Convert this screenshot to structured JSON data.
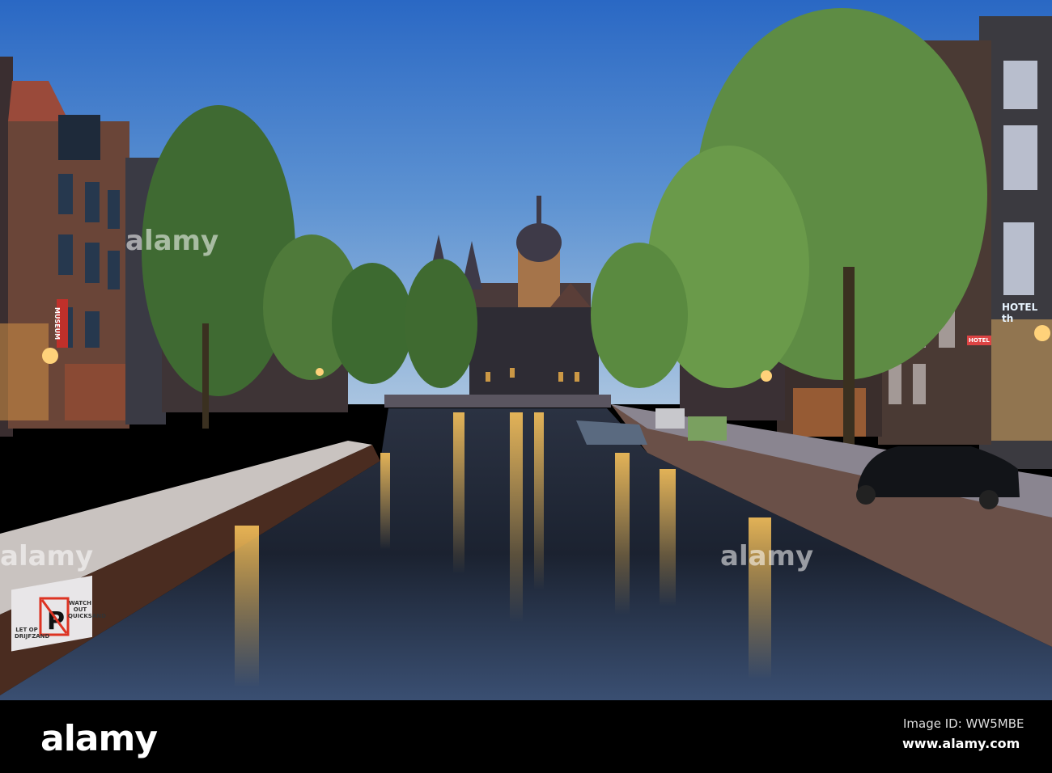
{
  "footer": {
    "logo": "alamy",
    "image_id": "Image ID: WW5MBE",
    "site": "www.alamy.com"
  },
  "watermarks": {
    "left": "alamy",
    "center": "alamy",
    "right": "alamy"
  },
  "signs": {
    "museum": "MUSEUM",
    "hotel_main": "HOTEL th",
    "hotel_small": "HOTEL",
    "let_op": "LET OP DRIJFZAND",
    "watch_out": "WATCH OUT QUICKSAND"
  },
  "colors": {
    "sky_top": "#2a68c4",
    "sky_bottom": "#a9c4e0",
    "water": "#141a22",
    "light": "#f3b34a"
  }
}
